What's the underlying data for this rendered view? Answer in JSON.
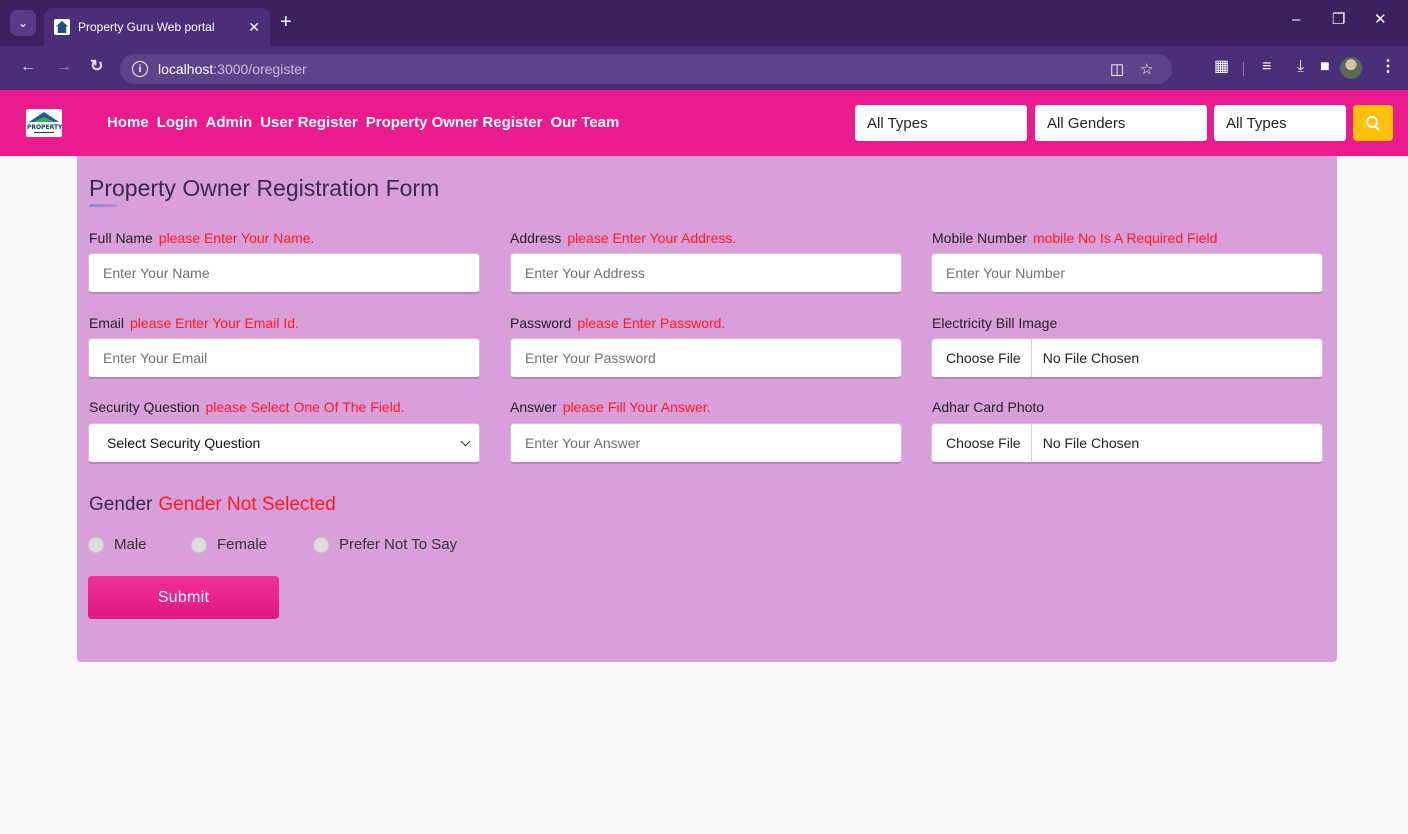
{
  "browser": {
    "tab_title": "Property Guru Web portal",
    "url_host": "localhost",
    "url_path": ":3000/oregister"
  },
  "site": {
    "logo_text": "PROPERTY",
    "nav": [
      "Home",
      "Login",
      "Admin",
      "User Register",
      "Property Owner Register",
      "Our Team"
    ],
    "filters": {
      "type1": "All Types",
      "gender": "All Genders",
      "type2": "All Types"
    }
  },
  "form": {
    "title": "Property Owner Registration Form",
    "full_name": {
      "label": "Full Name",
      "error": "please Enter Your Name.",
      "placeholder": "Enter Your Name"
    },
    "address": {
      "label": "Address",
      "error": "please Enter Your Address.",
      "placeholder": "Enter Your Address"
    },
    "mobile": {
      "label": "Mobile Number",
      "error": "mobile No Is A Required Field",
      "placeholder": "Enter Your Number"
    },
    "email": {
      "label": "Email",
      "error": "please Enter Your Email Id.",
      "placeholder": "Enter Your Email"
    },
    "password": {
      "label": "Password",
      "error": "please Enter Password.",
      "placeholder": "Enter Your Password"
    },
    "electricity_bill": {
      "label": "Electricity Bill Image",
      "button": "Choose File",
      "file_name": "No File Chosen"
    },
    "security_question": {
      "label": "Security Question",
      "error": "please Select One Of The Field.",
      "selected": "Select Security Question"
    },
    "answer": {
      "label": "Answer",
      "error": "please Fill Your Answer.",
      "placeholder": "Enter Your Answer"
    },
    "adhar_card": {
      "label": "Adhar Card Photo",
      "button": "Choose File",
      "file_name": "No File Chosen"
    },
    "gender": {
      "label": "Gender",
      "error": "Gender Not Selected",
      "options": [
        "Male",
        "Female",
        "Prefer Not To Say"
      ]
    },
    "submit_label": "Submit"
  },
  "colors": {
    "navbar": "#ea1b8c",
    "card": "#d99fdb",
    "error": "#ff1a1a",
    "search_button": "#ffc107"
  }
}
